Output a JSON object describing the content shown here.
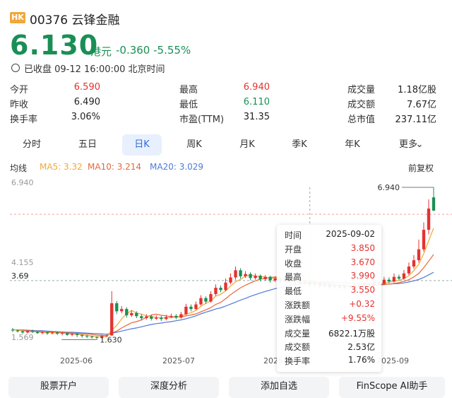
{
  "header": {
    "market_tag": "HK",
    "title": "00376 云锋金融",
    "price": "6.130",
    "unit": "港元",
    "change": "-0.360",
    "change_pct": "-5.55%",
    "status": "已收盘 09-12 16:00:00 北京时间"
  },
  "quote": [
    [
      {
        "label": "今开",
        "value": "6.590",
        "color": "red"
      },
      {
        "label": "最高",
        "value": "6.940",
        "color": "red"
      },
      {
        "label": "成交量",
        "value": "1.18亿股",
        "color": "plain"
      }
    ],
    [
      {
        "label": "昨收",
        "value": "6.490",
        "color": "plain"
      },
      {
        "label": "最低",
        "value": "6.110",
        "color": "green"
      },
      {
        "label": "成交额",
        "value": "7.67亿",
        "color": "plain"
      }
    ],
    [
      {
        "label": "换手率",
        "value": "3.06%",
        "color": "plain"
      },
      {
        "label": "市盈(TTM)",
        "value": "31.35",
        "color": "plain"
      },
      {
        "label": "总市值",
        "value": "237.11亿",
        "color": "plain"
      }
    ]
  ],
  "tabs": [
    "分时",
    "五日",
    "日K",
    "周K",
    "月K",
    "季K",
    "年K",
    "更多"
  ],
  "active_tab": "日K",
  "ma_bar": {
    "label": "均线",
    "ma5": "MA5: 3.32",
    "ma10": "MA10: 3.214",
    "ma20": "MA20: 3.029",
    "adjust": "前复权"
  },
  "colors": {
    "up": "#e5322f",
    "down": "#1a8f55",
    "ma5": "#f0a83a",
    "ma10": "#e8673c",
    "ma20": "#4f79d8"
  },
  "chart_data": {
    "type": "candlestick",
    "ylim": [
      1.569,
      6.94
    ],
    "y_ticks": [
      "6.940",
      "4.155",
      "3.69",
      "1.569"
    ],
    "x_ticks": [
      "2025-06",
      "2025-07",
      "2025-08",
      "2025-09"
    ],
    "markers": {
      "high_label": "6.940",
      "low_label": "1.630",
      "crosshair_y": "3.69"
    },
    "candles": [
      [
        1.98,
        1.95,
        2.04,
        1.9
      ],
      [
        1.95,
        1.92,
        1.99,
        1.88
      ],
      [
        1.92,
        1.88,
        1.96,
        1.84
      ],
      [
        1.88,
        1.93,
        1.97,
        1.85
      ],
      [
        1.93,
        1.9,
        1.98,
        1.86
      ],
      [
        1.9,
        1.86,
        1.94,
        1.83
      ],
      [
        1.86,
        1.89,
        1.92,
        1.82
      ],
      [
        1.89,
        1.85,
        1.91,
        1.8
      ],
      [
        1.85,
        1.88,
        1.92,
        1.81
      ],
      [
        1.88,
        1.84,
        1.91,
        1.79
      ],
      [
        1.84,
        1.86,
        1.9,
        1.78
      ],
      [
        1.86,
        1.8,
        1.89,
        1.76
      ],
      [
        1.8,
        1.83,
        1.87,
        1.75
      ],
      [
        1.83,
        1.79,
        1.86,
        1.72
      ],
      [
        1.79,
        1.76,
        1.82,
        1.7
      ],
      [
        1.76,
        1.74,
        1.8,
        1.68
      ],
      [
        1.74,
        1.72,
        1.77,
        1.66
      ],
      [
        1.72,
        1.7,
        1.75,
        1.63
      ],
      [
        1.7,
        1.76,
        1.8,
        1.66
      ],
      [
        1.76,
        1.78,
        1.82,
        1.72
      ],
      [
        1.78,
        2.9,
        3.32,
        1.76
      ],
      [
        2.9,
        2.62,
        2.98,
        2.52
      ],
      [
        2.62,
        2.7,
        2.8,
        2.55
      ],
      [
        2.7,
        2.48,
        2.76,
        2.4
      ],
      [
        2.48,
        2.56,
        2.66,
        2.42
      ],
      [
        2.56,
        2.45,
        2.62,
        2.38
      ],
      [
        2.45,
        2.38,
        2.52,
        2.3
      ],
      [
        2.38,
        2.44,
        2.52,
        2.33
      ],
      [
        2.44,
        2.36,
        2.5,
        2.3
      ],
      [
        2.36,
        2.4,
        2.48,
        2.32
      ],
      [
        2.4,
        2.35,
        2.46,
        2.28
      ],
      [
        2.35,
        2.42,
        2.5,
        2.3
      ],
      [
        2.42,
        2.46,
        2.54,
        2.38
      ],
      [
        2.46,
        2.4,
        2.52,
        2.34
      ],
      [
        2.4,
        2.52,
        2.6,
        2.36
      ],
      [
        2.52,
        2.78,
        2.88,
        2.48
      ],
      [
        2.78,
        2.7,
        2.86,
        2.62
      ],
      [
        2.7,
        2.86,
        2.96,
        2.66
      ],
      [
        2.86,
        3.08,
        3.18,
        2.82
      ],
      [
        3.08,
        2.96,
        3.14,
        2.88
      ],
      [
        2.96,
        3.22,
        3.32,
        2.92
      ],
      [
        3.22,
        3.44,
        3.56,
        3.16
      ],
      [
        3.44,
        3.36,
        3.52,
        3.28
      ],
      [
        3.36,
        3.62,
        3.76,
        3.32
      ],
      [
        3.62,
        3.8,
        3.94,
        3.56
      ],
      [
        3.8,
        4.05,
        4.18,
        3.72
      ],
      [
        4.05,
        3.84,
        4.12,
        3.76
      ],
      [
        3.84,
        3.92,
        4.02,
        3.78
      ],
      [
        3.92,
        3.78,
        3.98,
        3.7
      ],
      [
        3.78,
        3.86,
        3.94,
        3.72
      ],
      [
        3.86,
        3.74,
        3.9,
        3.66
      ],
      [
        3.74,
        3.82,
        3.88,
        3.68
      ],
      [
        3.82,
        3.7,
        3.86,
        3.62
      ],
      [
        3.7,
        3.76,
        3.84,
        3.64
      ],
      [
        3.76,
        3.66,
        3.8,
        3.58
      ],
      [
        3.66,
        3.72,
        3.78,
        3.6
      ],
      [
        3.72,
        3.62,
        3.76,
        3.54
      ],
      [
        3.62,
        3.68,
        3.74,
        3.56
      ],
      [
        3.68,
        3.58,
        3.72,
        3.5
      ],
      [
        3.58,
        3.64,
        3.7,
        3.52
      ],
      [
        3.64,
        3.54,
        3.68,
        3.46
      ],
      [
        3.54,
        3.6,
        3.66,
        3.48
      ],
      [
        3.6,
        3.5,
        3.64,
        3.42
      ],
      [
        3.5,
        3.56,
        3.62,
        3.44
      ],
      [
        3.56,
        3.46,
        3.6,
        3.4
      ],
      [
        3.46,
        3.52,
        3.58,
        3.4
      ],
      [
        3.52,
        3.44,
        3.56,
        3.38
      ],
      [
        3.44,
        3.5,
        3.58,
        3.38
      ],
      [
        3.5,
        3.46,
        3.56,
        3.4
      ],
      [
        3.46,
        3.54,
        3.62,
        3.42
      ],
      [
        3.54,
        3.48,
        3.6,
        3.44
      ],
      [
        3.48,
        3.58,
        3.66,
        3.44
      ],
      [
        3.58,
        3.52,
        3.64,
        3.48
      ],
      [
        3.52,
        3.64,
        3.72,
        3.48
      ],
      [
        3.64,
        3.58,
        3.7,
        3.52
      ],
      [
        3.58,
        3.72,
        3.82,
        3.54
      ],
      [
        3.72,
        3.66,
        3.8,
        3.6
      ],
      [
        3.66,
        3.82,
        3.94,
        3.62
      ],
      [
        3.82,
        3.76,
        3.9,
        3.7
      ],
      [
        3.76,
        3.94,
        4.06,
        3.72
      ],
      [
        3.94,
        4.18,
        4.32,
        3.88
      ],
      [
        4.18,
        4.4,
        4.58,
        4.1
      ],
      [
        4.4,
        4.78,
        5.12,
        4.32
      ],
      [
        4.78,
        5.46,
        5.72,
        4.7
      ],
      [
        5.46,
        6.2,
        6.52,
        5.3
      ],
      [
        6.59,
        6.13,
        6.94,
        6.11
      ]
    ],
    "ma5": [
      1.98,
      1.96,
      1.94,
      1.92,
      1.91,
      1.9,
      1.89,
      1.88,
      1.88,
      1.87,
      1.86,
      1.84,
      1.83,
      1.82,
      1.8,
      1.78,
      1.76,
      1.74,
      1.74,
      1.74,
      1.96,
      2.12,
      2.36,
      2.53,
      2.65,
      2.56,
      2.52,
      2.46,
      2.44,
      2.4,
      2.39,
      2.39,
      2.4,
      2.42,
      2.45,
      2.52,
      2.57,
      2.65,
      2.79,
      2.9,
      2.98,
      3.15,
      3.21,
      3.33,
      3.5,
      3.65,
      3.73,
      3.85,
      3.89,
      3.85,
      3.83,
      3.81,
      3.78,
      3.77,
      3.74,
      3.73,
      3.7,
      3.69,
      3.66,
      3.64,
      3.61,
      3.59,
      3.57,
      3.55,
      3.53,
      3.51,
      3.5,
      3.5,
      3.49,
      3.49,
      3.5,
      3.52,
      3.54,
      3.55,
      3.57,
      3.6,
      3.63,
      3.67,
      3.7,
      3.75,
      3.86,
      4.04,
      4.26,
      4.63,
      5.08,
      5.52
    ],
    "ma10": [
      1.98,
      1.97,
      1.96,
      1.94,
      1.93,
      1.92,
      1.91,
      1.9,
      1.9,
      1.89,
      1.88,
      1.87,
      1.86,
      1.85,
      1.84,
      1.83,
      1.81,
      1.79,
      1.78,
      1.77,
      1.86,
      1.93,
      2.04,
      2.13,
      2.22,
      2.26,
      2.32,
      2.41,
      2.49,
      2.52,
      2.48,
      2.46,
      2.43,
      2.43,
      2.42,
      2.46,
      2.49,
      2.53,
      2.6,
      2.67,
      2.75,
      2.86,
      2.93,
      3.06,
      3.2,
      3.32,
      3.44,
      3.53,
      3.61,
      3.68,
      3.74,
      3.77,
      3.8,
      3.81,
      3.8,
      3.78,
      3.76,
      3.74,
      3.72,
      3.7,
      3.67,
      3.65,
      3.62,
      3.6,
      3.58,
      3.56,
      3.54,
      3.53,
      3.52,
      3.51,
      3.51,
      3.51,
      3.52,
      3.52,
      3.53,
      3.55,
      3.57,
      3.59,
      3.62,
      3.66,
      3.72,
      3.82,
      3.94,
      4.14,
      4.37,
      4.6
    ],
    "ma20": [
      1.98,
      1.97,
      1.97,
      1.96,
      1.95,
      1.94,
      1.94,
      1.93,
      1.92,
      1.91,
      1.9,
      1.89,
      1.89,
      1.88,
      1.87,
      1.86,
      1.85,
      1.84,
      1.83,
      1.82,
      1.86,
      1.89,
      1.93,
      1.97,
      2.01,
      2.04,
      2.08,
      2.12,
      2.16,
      2.19,
      2.21,
      2.24,
      2.26,
      2.29,
      2.32,
      2.36,
      2.41,
      2.46,
      2.53,
      2.59,
      2.64,
      2.7,
      2.74,
      2.8,
      2.87,
      2.94,
      3.01,
      3.07,
      3.14,
      3.2,
      3.26,
      3.31,
      3.36,
      3.41,
      3.45,
      3.49,
      3.52,
      3.55,
      3.57,
      3.59,
      3.61,
      3.62,
      3.63,
      3.63,
      3.63,
      3.63,
      3.62,
      3.62,
      3.61,
      3.6,
      3.59,
      3.58,
      3.57,
      3.57,
      3.56,
      3.56,
      3.57,
      3.58,
      3.59,
      3.61,
      3.64,
      3.68,
      3.73,
      3.8,
      3.89,
      3.98
    ]
  },
  "tooltip": [
    {
      "label": "时间",
      "value": "2025-09-02",
      "color": "plain"
    },
    {
      "label": "开盘",
      "value": "3.850",
      "color": "red"
    },
    {
      "label": "收盘",
      "value": "3.670",
      "color": "red"
    },
    {
      "label": "最高",
      "value": "3.990",
      "color": "red"
    },
    {
      "label": "最低",
      "value": "3.550",
      "color": "red"
    },
    {
      "label": "涨跌额",
      "value": "+0.32",
      "color": "red"
    },
    {
      "label": "涨跌幅",
      "value": "+9.55%",
      "color": "red"
    },
    {
      "label": "成交量",
      "value": "6822.1万股",
      "color": "plain"
    },
    {
      "label": "成交额",
      "value": "2.53亿",
      "color": "plain"
    },
    {
      "label": "换手率",
      "value": "1.76%",
      "color": "plain"
    }
  ],
  "bottom_bar": [
    "股票开户",
    "深度分析",
    "添加自选",
    "FinScope AI助手"
  ]
}
